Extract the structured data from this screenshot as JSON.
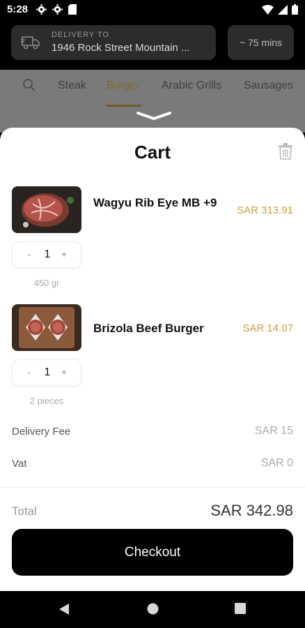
{
  "status_bar": {
    "time": "5:28"
  },
  "delivery": {
    "label": "DELIVERY TO",
    "address": "1946 Rock Street Mountain ...",
    "eta": "~ 75 mins"
  },
  "categories": {
    "tabs": [
      {
        "label": "Steak",
        "active": false
      },
      {
        "label": "Burger",
        "active": true
      },
      {
        "label": "Arabic Grills",
        "active": false
      },
      {
        "label": "Sausages",
        "active": false
      }
    ]
  },
  "cart": {
    "title": "Cart",
    "items": [
      {
        "name": "Wagyu Rib Eye MB +9",
        "price": "SAR 313.91",
        "qty": "1",
        "minus": "-",
        "plus": "+",
        "unit": "450 gr"
      },
      {
        "name": "Brizola Beef Burger",
        "price": "SAR 14.07",
        "qty": "1",
        "minus": "-",
        "plus": "+",
        "unit": "2 pieces"
      }
    ],
    "delivery_fee_label": "Delivery Fee",
    "delivery_fee_value": "SAR 15",
    "vat_label": "Vat",
    "vat_value": "SAR 0",
    "total_label": "Total",
    "total_value": "SAR 342.98",
    "checkout_label": "Checkout"
  },
  "colors": {
    "accent_gold": "#c7a042",
    "sheet": "#ffffff",
    "dark": "#000000"
  }
}
